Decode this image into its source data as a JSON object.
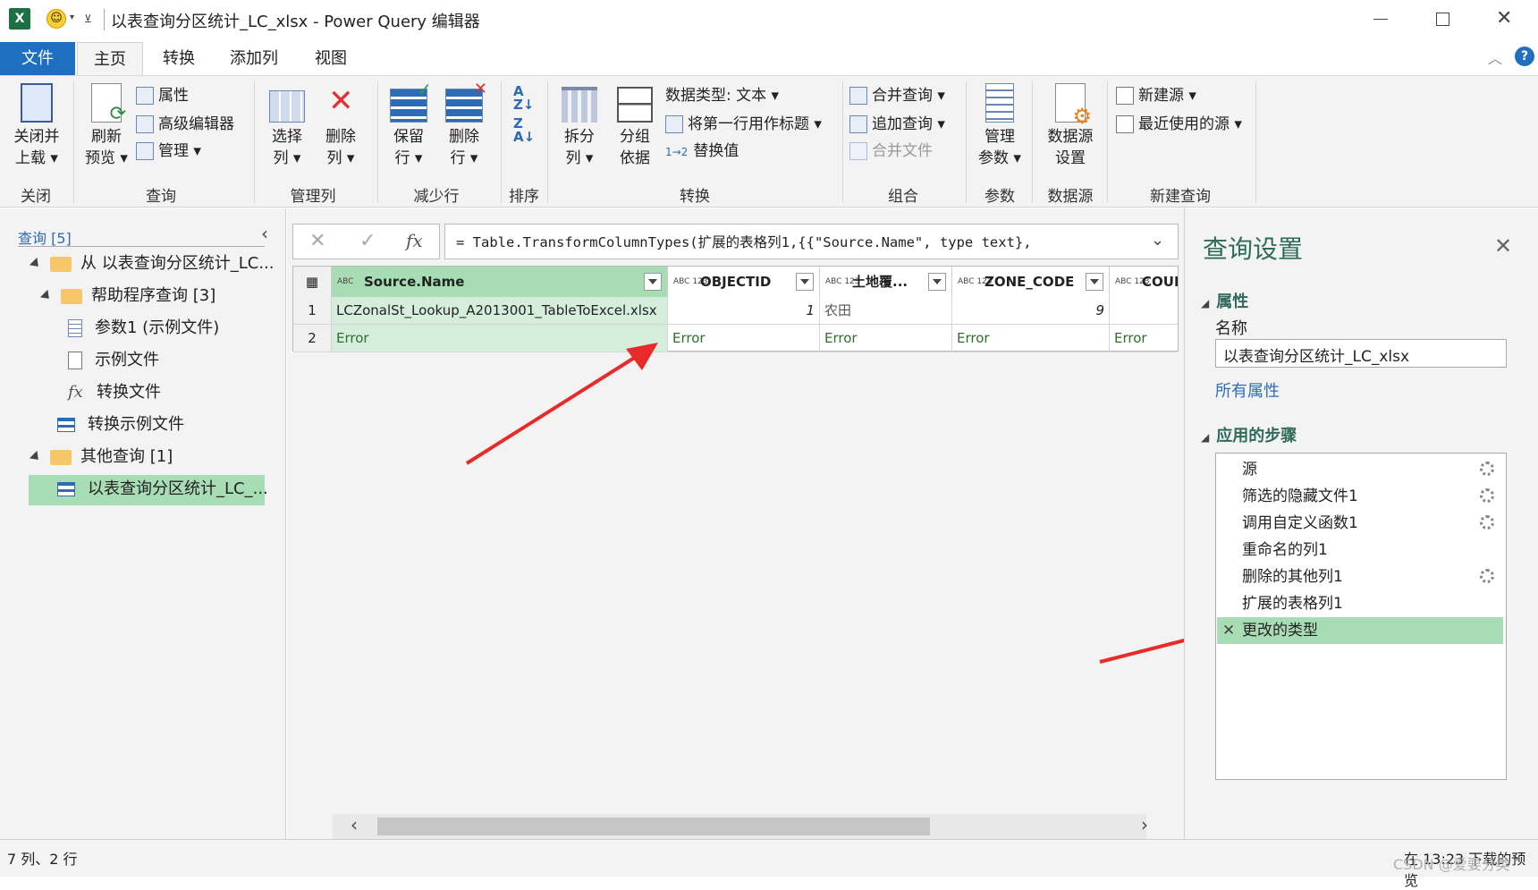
{
  "titlebar": {
    "excel_icon": "excel-icon",
    "smiley": "smiley-icon",
    "title": "以表查询分区统计_LC_xlsx - Power Query 编辑器"
  },
  "menu": {
    "tabs": [
      "文件",
      "主页",
      "转换",
      "添加列",
      "视图"
    ]
  },
  "ribbon": {
    "close_load": {
      "line1": "关闭并",
      "line2": "上载"
    },
    "refresh": {
      "line1": "刷新",
      "line2": "预览"
    },
    "properties": "属性",
    "advanced_editor": "高级编辑器",
    "manage": "管理",
    "choose_cols": {
      "line1": "选择",
      "line2": "列"
    },
    "remove_cols": {
      "line1": "删除",
      "line2": "列"
    },
    "keep_rows": {
      "line1": "保留",
      "line2": "行"
    },
    "remove_rows": {
      "line1": "删除",
      "line2": "行"
    },
    "split": {
      "line1": "拆分",
      "line2": "列"
    },
    "group": {
      "line1": "分组",
      "line2": "依据"
    },
    "data_type": "数据类型: 文本",
    "first_row_header": "将第一行用作标题",
    "replace_values": "替换值",
    "merge_queries": "合并查询",
    "append_queries": "追加查询",
    "combine_files": "合并文件",
    "manage_params": {
      "line1": "管理",
      "line2": "参数"
    },
    "datasource_settings": {
      "line1": "数据源",
      "line2": "设置"
    },
    "new_source": "新建源",
    "recent_sources": "最近使用的源",
    "groups": {
      "close": "关闭",
      "query": "查询",
      "manage_cols": "管理列",
      "reduce_rows": "减少行",
      "sort": "排序",
      "transform": "转换",
      "combine": "组合",
      "params": "参数",
      "datasource": "数据源",
      "new_query": "新建查询"
    }
  },
  "leftpane": {
    "header": "查询 [5]",
    "items": [
      "从 以表查询分区统计_LC...",
      "帮助程序查询 [3]",
      "参数1 (示例文件)",
      "示例文件",
      "转换文件",
      "转换示例文件",
      "其他查询 [1]",
      "以表查询分区统计_LC_..."
    ]
  },
  "formula": {
    "fx": "fx",
    "text": "= Table.TransformColumnTypes(扩展的表格列1,{{\"Source.Name\", type text},"
  },
  "grid": {
    "columns": [
      {
        "type": "ABC",
        "name": "Source.Name"
      },
      {
        "type": "ABC 123",
        "name": "OBJECTID"
      },
      {
        "type": "ABC 123",
        "name": "土地覆..."
      },
      {
        "type": "ABC 123",
        "name": "ZONE_CODE"
      },
      {
        "type": "ABC 123",
        "name": "COUN"
      }
    ],
    "rows": [
      {
        "num": "1",
        "cells": [
          "LCZonalSt_Lookup_A2013001_TableToExcel.xlsx",
          "1",
          "农田",
          "9",
          ""
        ]
      },
      {
        "num": "2",
        "cells": [
          "Error",
          "Error",
          "Error",
          "Error",
          "Error"
        ]
      }
    ]
  },
  "rightpane": {
    "title": "查询设置",
    "properties_header": "属性",
    "name_label": "名称",
    "name_value": "以表查询分区统计_LC_xlsx",
    "all_props": "所有属性",
    "steps_header": "应用的步骤",
    "steps": [
      "源",
      "筛选的隐藏文件1",
      "调用自定义函数1",
      "重命名的列1",
      "删除的其他列1",
      "扩展的表格列1",
      "更改的类型"
    ]
  },
  "status": {
    "left": "7 列、2 行",
    "right": "在 13:23 下载的预览",
    "watermark": "CSDN @爱要分类"
  },
  "colors": {
    "file_tab": "#1f6fc0",
    "selected": "#a8dcb4",
    "arrow": "#e82a2a"
  }
}
